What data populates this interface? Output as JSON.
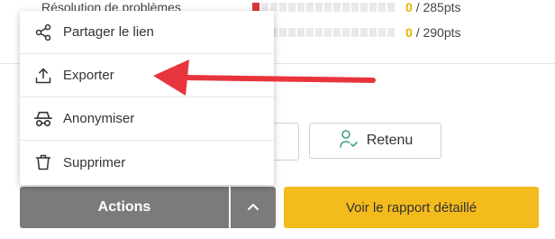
{
  "scores": [
    {
      "label": "Résolution de problèmes",
      "current": "0",
      "total": "/ 285pts",
      "filled": 1
    },
    {
      "label": "",
      "current": "0",
      "total": "/ 290pts",
      "filled": 0
    }
  ],
  "menu": {
    "items": [
      {
        "label": "Partager le lien",
        "icon": "share-icon"
      },
      {
        "label": "Exporter",
        "icon": "upload-icon"
      },
      {
        "label": "Anonymiser",
        "icon": "incognito-icon"
      },
      {
        "label": "Supprimer",
        "icon": "trash-icon"
      }
    ]
  },
  "buttons": {
    "actions_label": "Actions",
    "retenu_label": "Retenu",
    "report_label": "Voir le rapport détaillé"
  },
  "colors": {
    "accent_yellow": "#f4bb1d",
    "actions_gray": "#7b7b7b",
    "arrow_red": "#e8353d",
    "score_red": "#d9363e",
    "retenu_icon_green": "#3aa57a"
  }
}
